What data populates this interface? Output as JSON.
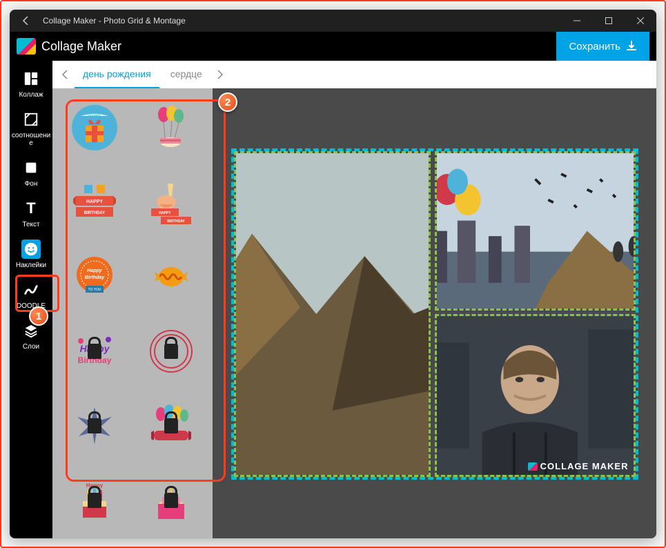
{
  "window": {
    "title": "Collage Maker - Photo Grid & Montage"
  },
  "app": {
    "name": "Collage Maker",
    "save_label": "Сохранить",
    "watermark": "COLLAGE MAKER"
  },
  "sidebar": {
    "items": [
      {
        "label": "Коллаж",
        "icon": "grid"
      },
      {
        "label": "соотношение",
        "icon": "ratio"
      },
      {
        "label": "Фон",
        "icon": "square"
      },
      {
        "label": "Текст",
        "icon": "text"
      },
      {
        "label": "Наклейки",
        "icon": "smile",
        "active": true
      },
      {
        "label": "DOODLE",
        "icon": "doodle"
      },
      {
        "label": "Слои",
        "icon": "layers"
      }
    ]
  },
  "categories": {
    "items": [
      {
        "label": "день рождения",
        "active": true
      },
      {
        "label": "сердце",
        "active": false
      }
    ]
  },
  "stickers": [
    {
      "id": "gift-circle",
      "locked": false
    },
    {
      "id": "balloons-cake",
      "locked": false
    },
    {
      "id": "happy-birthday-ribbon",
      "locked": false
    },
    {
      "id": "cheers-glass",
      "locked": false
    },
    {
      "id": "happy-birthday-badge",
      "locked": false
    },
    {
      "id": "candy",
      "locked": false
    },
    {
      "id": "birthday-purple",
      "locked": true
    },
    {
      "id": "birthday-stamp",
      "locked": true
    },
    {
      "id": "star-burst",
      "locked": true
    },
    {
      "id": "balloons-ribbon",
      "locked": true
    },
    {
      "id": "cake-red",
      "locked": true
    },
    {
      "id": "cake-pink",
      "locked": true
    }
  ],
  "annotations": [
    {
      "num": "1"
    },
    {
      "num": "2"
    }
  ],
  "collage_images": [
    {
      "name": "mountains"
    },
    {
      "name": "balloons-city"
    },
    {
      "name": "man-portrait"
    }
  ]
}
